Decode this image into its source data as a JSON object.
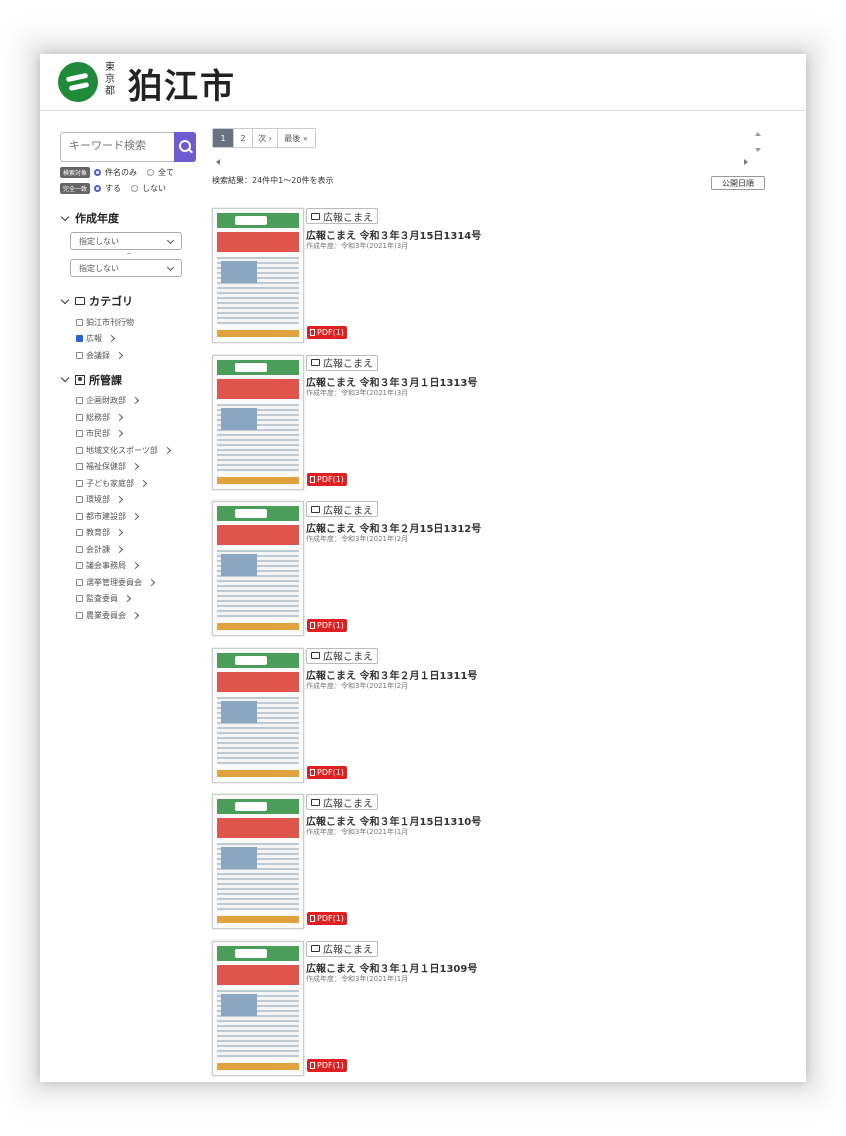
{
  "header": {
    "logo_small": "東京都",
    "logo_title": "狛江市"
  },
  "sidebar": {
    "search_placeholder": "キーワード検索",
    "target_tag": "検索対象",
    "target_options": [
      "件名のみ",
      "全て"
    ],
    "match_tag": "完全一致",
    "match_options": [
      "する",
      "しない"
    ],
    "year_section": "作成年度",
    "year_from": "指定しない",
    "year_tilde": "~",
    "year_to": "指定しない",
    "category_section": "カテゴリ",
    "categories": [
      {
        "label": "狛江市刊行物",
        "checked": false,
        "has_children": false
      },
      {
        "label": "広報",
        "checked": true,
        "has_children": true
      },
      {
        "label": "会議録",
        "checked": false,
        "has_children": true
      }
    ],
    "department_section": "所管課",
    "departments": [
      "企画財政部",
      "総務部",
      "市民部",
      "地域文化スポーツ部",
      "福祉保健部",
      "子ども家庭部",
      "環境部",
      "都市建設部",
      "教育部",
      "会計課",
      "議会事務局",
      "選挙管理委員会",
      "監査委員",
      "農業委員会"
    ]
  },
  "main": {
    "pager": {
      "page1": "1",
      "page2": "2",
      "next": "次 ›",
      "last": "最後 »"
    },
    "count_text": "検索結果：24件中1～20件を表示",
    "sort_label": "公開日順",
    "items": [
      {
        "tag": "広報こまえ",
        "title": "広報こまえ 令和３年３月15日1314号",
        "meta": "作成年度：令和3年(2021年)3月",
        "pdf": "PDF(1)"
      },
      {
        "tag": "広報こまえ",
        "title": "広報こまえ 令和３年３月１日1313号",
        "meta": "作成年度：令和3年(2021年)3月",
        "pdf": "PDF(1)"
      },
      {
        "tag": "広報こまえ",
        "title": "広報こまえ 令和３年２月15日1312号",
        "meta": "作成年度：令和3年(2021年)2月",
        "pdf": "PDF(1)"
      },
      {
        "tag": "広報こまえ",
        "title": "広報こまえ 令和３年２月１日1311号",
        "meta": "作成年度：令和3年(2021年)2月",
        "pdf": "PDF(1)"
      },
      {
        "tag": "広報こまえ",
        "title": "広報こまえ 令和３年１月15日1310号",
        "meta": "作成年度：令和3年(2021年)1月",
        "pdf": "PDF(1)"
      },
      {
        "tag": "広報こまえ",
        "title": "広報こまえ 令和３年１月１日1309号",
        "meta": "作成年度：令和3年(2021年)1月",
        "pdf": "PDF(1)"
      }
    ]
  },
  "colors": {
    "accent": "#6d5bd0",
    "pdf_badge": "#e02020",
    "logo_green": "#1f8a3a"
  }
}
